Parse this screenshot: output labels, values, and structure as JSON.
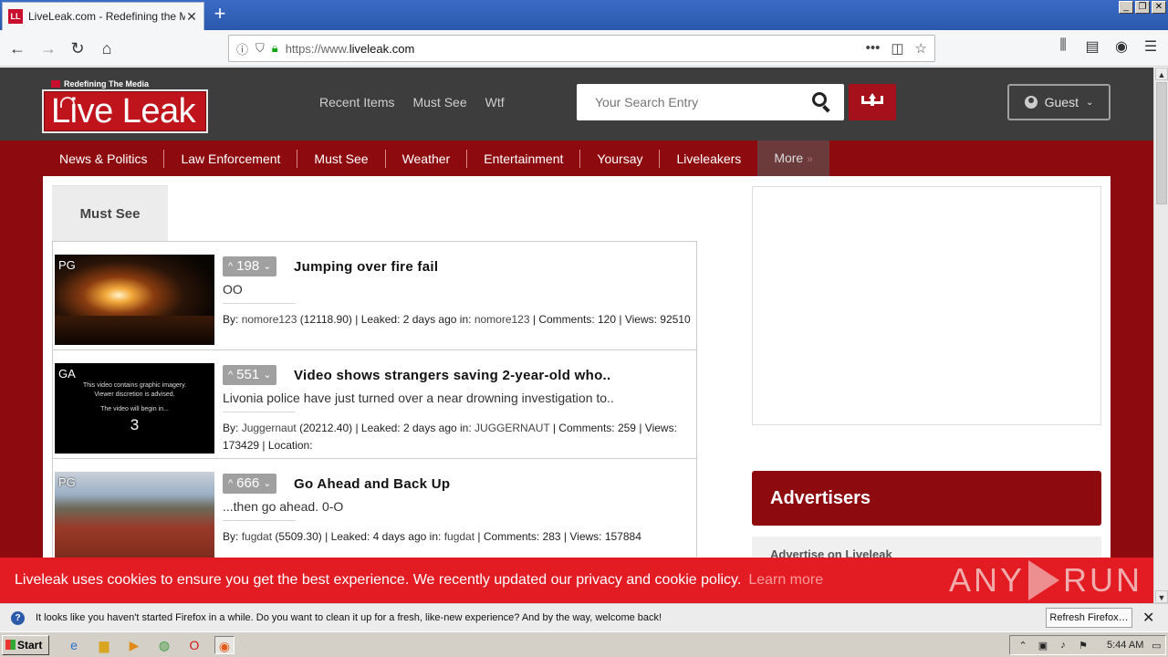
{
  "browser": {
    "tab_title": "LiveLeak.com - Redefining the Media",
    "tab_favicon": "LL",
    "url_prefix": "https://www.",
    "url_host": "liveleak.com",
    "new_tab": "+",
    "close_glyph": "✕"
  },
  "site": {
    "logo_tagline": "Redefining The Media",
    "logo_text": "Live Leak",
    "toplinks": [
      "Recent Items",
      "Must See",
      "Wtf"
    ],
    "search_placeholder": "Your Search Entry",
    "guest_label": "Guest",
    "categories": [
      "News & Politics",
      "Law Enforcement",
      "Must See",
      "Weather",
      "Entertainment",
      "Yoursay",
      "Liveleakers"
    ],
    "more_label": "More",
    "more_glyph": "»",
    "tab_label": "Must See"
  },
  "items": [
    {
      "rating": "PG",
      "votes": "198",
      "title": "Jumping over fire fail",
      "desc": "OO",
      "by_label": "By:",
      "user": "nomore123",
      "score": "(12118.90)",
      "leaked_label": "| Leaked: 2 days ago in:",
      "channel": "nomore123",
      "comments": "| Comments: 120 |",
      "views": "Views: 92510",
      "location": ""
    },
    {
      "rating": "GA",
      "votes": "551",
      "title": "Video shows strangers saving 2-year-old who..",
      "desc": "Livonia police have just turned over a near drowning investigation to..",
      "by_label": "By:",
      "user": "Juggernaut",
      "score": "(20212.40)",
      "leaked_label": "| Leaked: 2 days ago in:",
      "channel": "JUGGERNAUT",
      "comments": "| Comments: 259 |",
      "views": "Views: 173429",
      "location": "| Location:",
      "graphic_line1": "This video contains graphic imagery.",
      "graphic_line2": "Viewer discretion is advised.",
      "graphic_line3": "The video will begin in...",
      "graphic_count": "3"
    },
    {
      "rating": "PG",
      "votes": "666",
      "title": "Go Ahead and Back Up",
      "desc": "...then go ahead. 0-O",
      "by_label": "By:",
      "user": "fugdat",
      "score": "(5509.30)",
      "leaked_label": "| Leaked: 4 days ago in:",
      "channel": "fugdat",
      "comments": "| Comments: 283 |",
      "views": "Views: 157884",
      "location": ""
    }
  ],
  "sidebar": {
    "advertisers_title": "Advertisers",
    "advertise_item": "Advertise on Liveleak"
  },
  "cookie": {
    "text": "Liveleak uses cookies to ensure you get the best experience. We recently updated our privacy and cookie policy.",
    "link": "Learn more"
  },
  "watermark": {
    "left": "ANY",
    "right": "RUN"
  },
  "notification": {
    "text": "It looks like you haven't started Firefox in a while. Do you want to clean it up for a fresh, like-new experience? And by the way, welcome back!",
    "button": "Refresh Firefox…",
    "info_glyph": "?"
  },
  "taskbar": {
    "start_label": "Start",
    "clock": "5:44 AM"
  },
  "colors": {
    "brand_red": "#c0141c",
    "nav_red": "#8d0a0f",
    "header_dark": "#3d3d3d",
    "cookie_red": "#e31b23"
  }
}
